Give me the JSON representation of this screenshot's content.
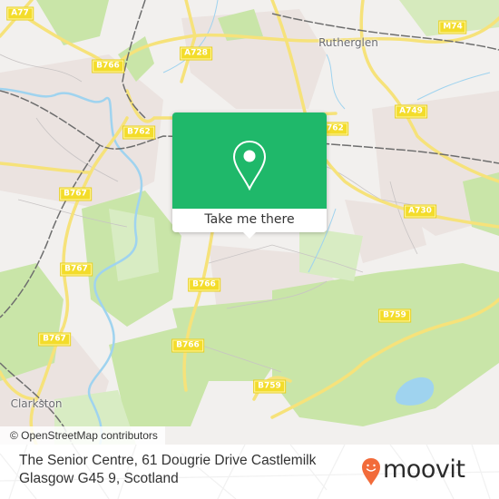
{
  "map": {
    "place_labels": [
      {
        "id": "rutherglen",
        "text": "Rutherglen"
      },
      {
        "id": "clarkston",
        "text": "Clarkston"
      }
    ],
    "road_labels": [
      {
        "id": "a77",
        "text": "A77"
      },
      {
        "id": "b766-north",
        "text": "B766"
      },
      {
        "id": "a728",
        "text": "A728"
      },
      {
        "id": "m74",
        "text": "M74"
      },
      {
        "id": "b762-west",
        "text": "B762"
      },
      {
        "id": "b762-east",
        "text": "B762"
      },
      {
        "id": "a749",
        "text": "A749"
      },
      {
        "id": "b767-north",
        "text": "B767"
      },
      {
        "id": "a730",
        "text": "A730"
      },
      {
        "id": "b767-middle",
        "text": "B767"
      },
      {
        "id": "b766-middle",
        "text": "B766"
      },
      {
        "id": "b759-east",
        "text": "B759"
      },
      {
        "id": "b767-south",
        "text": "B767"
      },
      {
        "id": "b766-south",
        "text": "B766"
      },
      {
        "id": "b759-south",
        "text": "B759"
      }
    ],
    "attribution": "© OpenStreetMap contributors",
    "colors": {
      "background": "#f2f0ee",
      "park": "#c9e5a8",
      "urban": "#ebe3e0",
      "water": "#9fd3ef",
      "road_major": "#f6e27a",
      "railway": "#6e6e6e"
    }
  },
  "popup": {
    "icon": "map-pin-icon",
    "cta_label": "Take me there",
    "accent_color": "#1fb86a"
  },
  "footer": {
    "address_line1": "The Senior Centre, 61 Dougrie Drive Castlemilk",
    "address_line2": "Glasgow G45 9, Scotland",
    "brand": "moovit",
    "brand_color": "#f26b3a"
  }
}
